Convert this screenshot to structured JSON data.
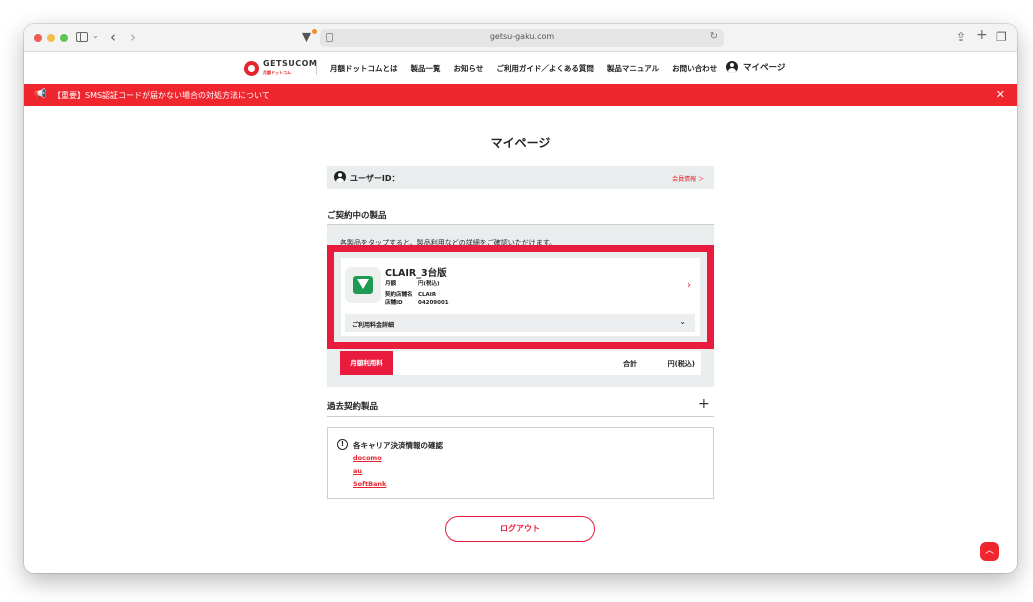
{
  "browser": {
    "url": "getsu-gaku.com",
    "icons": [
      "sidebar-icon",
      "back-icon",
      "forward-icon",
      "shield-icon",
      "reload-icon",
      "share-icon",
      "new-tab-icon",
      "tabs-overview-icon"
    ]
  },
  "header": {
    "logo_text": "GETSUCOM",
    "logo_sub": "月額ドットコム",
    "nav": [
      "月額ドットコムとは",
      "製品一覧",
      "お知らせ",
      "ご利用ガイド／よくある質問",
      "製品マニュアル",
      "お問い合わせ"
    ],
    "mypage": "マイページ"
  },
  "alert": {
    "message": "【重要】SMS認証コードが届かない場合の対処方法について",
    "color": "#f0262f"
  },
  "main": {
    "title": "マイページ",
    "user_label": "ユーザーID：",
    "member_info": "会員情報 ＞",
    "contracts_heading": "ご契約中の製品",
    "contracts_note": "各製品をタップすると、製品利用などの詳細をご確認いただけます。",
    "product": {
      "name": "CLAIR_3台版",
      "price_label": "月額",
      "price_value": "円(税込)",
      "store_label": "契約店舗名",
      "store_value": "CLAIR",
      "store_id_label": "店舗ID",
      "store_id_value": "04209001",
      "fee_detail": "ご利用料金詳細"
    },
    "monthly_tab": "月額利用料",
    "total_label": "合計",
    "total_value": "円(税込)",
    "past_heading": "過去契約製品",
    "carrier_title": "各キャリア決済情報の確認",
    "carriers": [
      "docomo",
      "au",
      "SoftBank"
    ],
    "logout": "ログアウト"
  },
  "colors": {
    "accent": "#ea1c3d",
    "panel": "#e9edee",
    "product_green": "#1f9a52"
  }
}
